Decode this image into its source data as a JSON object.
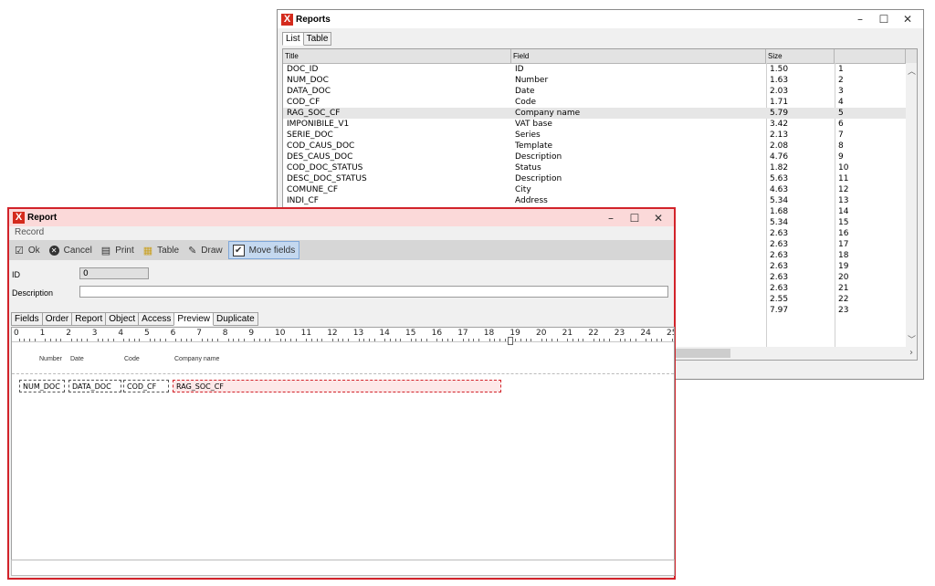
{
  "reports_window": {
    "title": "Reports",
    "controls": {
      "minimize": "–",
      "maximize": "☐",
      "close": "✕"
    },
    "tabs": [
      {
        "label": "List",
        "active": true
      },
      {
        "label": "Table",
        "active": false
      }
    ],
    "columns": [
      "Title",
      "Field",
      "Size",
      ""
    ],
    "rows": [
      {
        "title": "DOC_ID",
        "field": "ID",
        "size": "1.50",
        "num": "1"
      },
      {
        "title": "NUM_DOC",
        "field": "Number",
        "size": "1.63",
        "num": "2"
      },
      {
        "title": "DATA_DOC",
        "field": "Date",
        "size": "2.03",
        "num": "3"
      },
      {
        "title": "COD_CF",
        "field": "Code",
        "size": "1.71",
        "num": "4"
      },
      {
        "title": "RAG_SOC_CF",
        "field": "Company name",
        "size": "5.79",
        "num": "5",
        "selected": true
      },
      {
        "title": "IMPONIBILE_V1",
        "field": "VAT base",
        "size": "3.42",
        "num": "6"
      },
      {
        "title": "SERIE_DOC",
        "field": "Series",
        "size": "2.13",
        "num": "7"
      },
      {
        "title": "COD_CAUS_DOC",
        "field": "Template",
        "size": "2.08",
        "num": "8"
      },
      {
        "title": "DES_CAUS_DOC",
        "field": "Description",
        "size": "4.76",
        "num": "9"
      },
      {
        "title": "COD_DOC_STATUS",
        "field": "Status",
        "size": "1.82",
        "num": "10"
      },
      {
        "title": "DESC_DOC_STATUS",
        "field": "Description",
        "size": "5.63",
        "num": "11"
      },
      {
        "title": "COMUNE_CF",
        "field": "City",
        "size": "4.63",
        "num": "12"
      },
      {
        "title": "INDI_CF",
        "field": "Address",
        "size": "5.34",
        "num": "13"
      },
      {
        "title": "",
        "field": "",
        "size": "1.68",
        "num": "14"
      },
      {
        "title": "",
        "field": "",
        "size": "5.34",
        "num": "15"
      },
      {
        "title": "",
        "field": "",
        "size": "2.63",
        "num": "16"
      },
      {
        "title": "",
        "field": "",
        "size": "2.63",
        "num": "17"
      },
      {
        "title": "",
        "field": "",
        "size": "2.63",
        "num": "18"
      },
      {
        "title": "",
        "field": "",
        "size": "2.63",
        "num": "19"
      },
      {
        "title": "",
        "field": "",
        "size": "2.63",
        "num": "20"
      },
      {
        "title": "",
        "field": "",
        "size": "2.63",
        "num": "21"
      },
      {
        "title": "",
        "field": "",
        "size": "2.55",
        "num": "22"
      },
      {
        "title": "",
        "field": "",
        "size": "7.97",
        "num": "23"
      }
    ]
  },
  "report_window": {
    "title": "Report",
    "controls": {
      "minimize": "–",
      "maximize": "☐",
      "close": "✕"
    },
    "menu": "Record",
    "toolbar": {
      "ok": "Ok",
      "cancel": "Cancel",
      "print": "Print",
      "table": "Table",
      "draw": "Draw",
      "move_fields": "Move fields"
    },
    "icons": {
      "ok": "check-box-icon",
      "cancel": "cancel-circle-icon",
      "print": "printer-icon",
      "table": "table-icon",
      "draw": "pencil-icon",
      "move_fields": "checkbox-checked-icon"
    },
    "form": {
      "id_label": "ID",
      "id_value": "0",
      "description_label": "Description",
      "description_value": ""
    },
    "tabs": [
      {
        "label": "Fields",
        "active": false
      },
      {
        "label": "Order",
        "active": false
      },
      {
        "label": "Report",
        "active": false
      },
      {
        "label": "Object",
        "active": false
      },
      {
        "label": "Access",
        "active": false
      },
      {
        "label": "Preview",
        "active": true
      },
      {
        "label": "Duplicate",
        "active": false
      }
    ],
    "ruler": [
      "0",
      "1",
      "2",
      "3",
      "4",
      "5",
      "6",
      "7",
      "8",
      "9",
      "10",
      "11",
      "12",
      "13",
      "14",
      "15",
      "16",
      "17",
      "18",
      "19",
      "20",
      "21",
      "22",
      "23",
      "24",
      "25"
    ],
    "column_headers": [
      "Number",
      "Date",
      "Code",
      "Company name"
    ],
    "fields": [
      {
        "label": "NUM_DOC",
        "selected": false
      },
      {
        "label": "DATA_DOC",
        "selected": false
      },
      {
        "label": "COD_CF",
        "selected": false
      },
      {
        "label": "RAG_SOC_CF",
        "selected": true
      }
    ]
  },
  "colors": {
    "accent_red": "#d2232a",
    "report_titlebar": "#fbd9d9",
    "toolbar": "#d6d6d6",
    "toggle_active": "#c4d8ef"
  }
}
